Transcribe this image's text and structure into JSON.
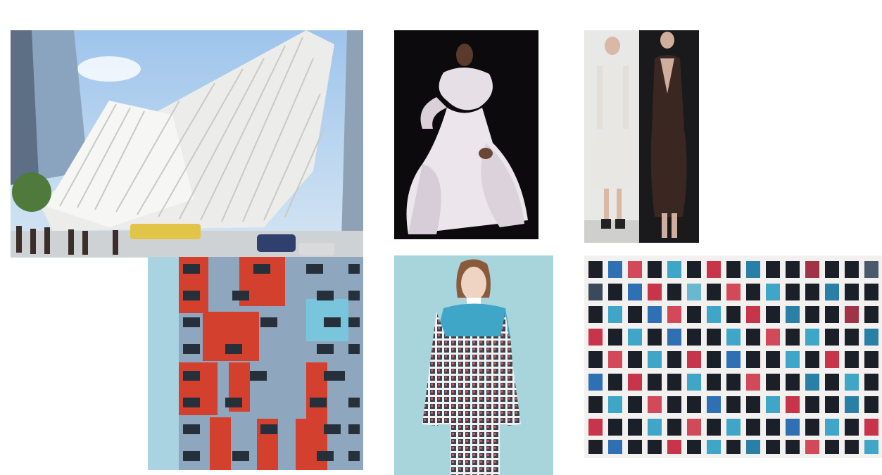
{
  "collage": {
    "photos": [
      {
        "id": "arch",
        "icon": "white-ribbed-building-photo"
      },
      {
        "id": "gown",
        "icon": "sculptural-white-gown-photo"
      },
      {
        "id": "duo",
        "icon": "two-models-runway-photo"
      },
      {
        "id": "facade",
        "icon": "red-blue-facade-photo"
      },
      {
        "id": "model",
        "icon": "model-grid-coat-photo"
      },
      {
        "id": "grid",
        "icon": "colorful-grid-texture-photo"
      }
    ]
  },
  "colors": {
    "sky": "#b9d3ee",
    "white_structure": "#f4f4f2",
    "facade_red": "#d4402e",
    "facade_blue": "#8fa6bf",
    "aqua_backdrop": "#a8d4dc",
    "accent_teal": "#3fa6c8"
  }
}
